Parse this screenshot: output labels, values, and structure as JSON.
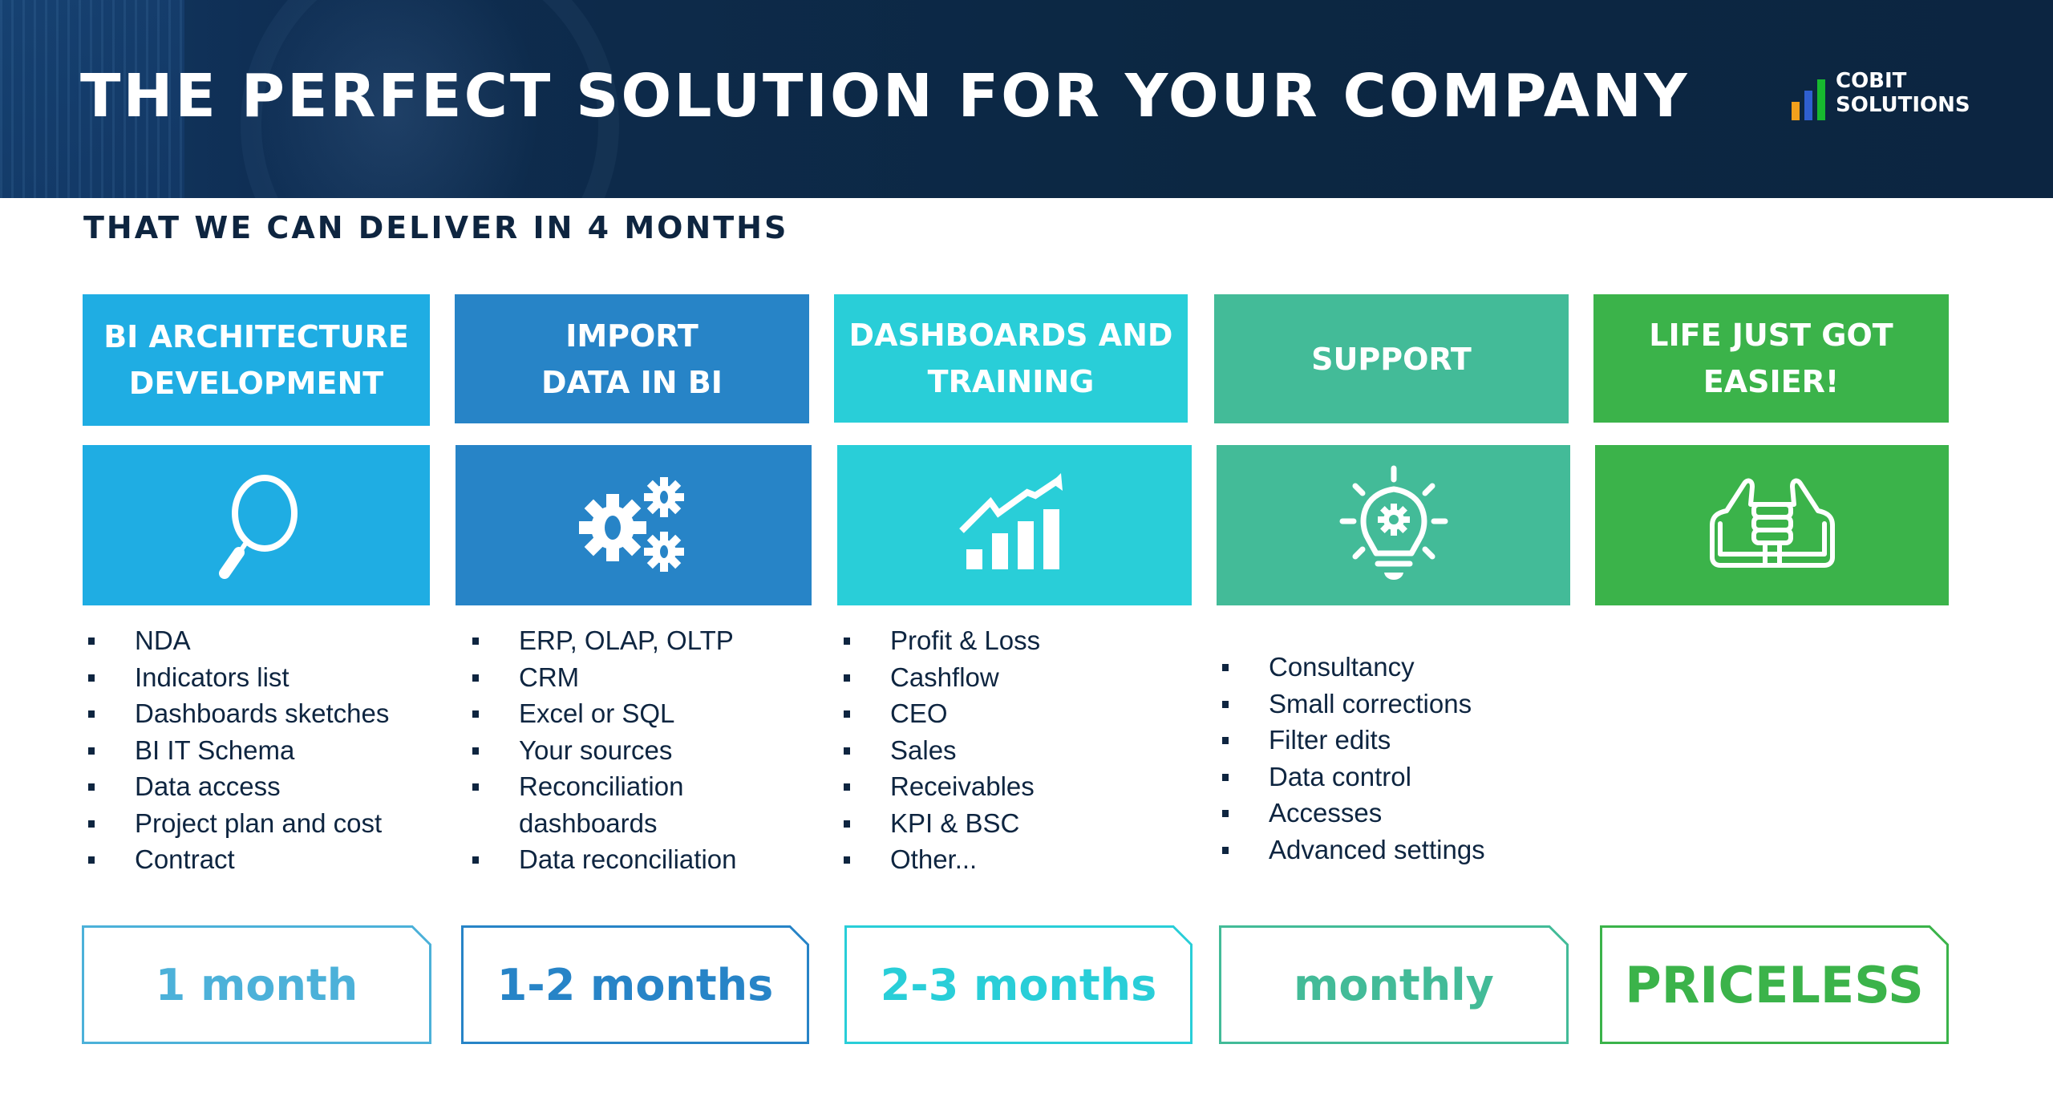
{
  "header": {
    "title": "THE PERFECT SOLUTION FOR YOUR COMPANY",
    "logo": {
      "line1": "COBIT",
      "line2": "SOLUTIONS",
      "bar_colors": [
        "#f2a01c",
        "#2f5fd0",
        "#17b92f"
      ]
    }
  },
  "subtitle": "THAT WE CAN DELIVER IN 4 MONTHS",
  "columns": [
    {
      "title": "BI ARCHITECTURE\nDEVELOPMENT",
      "icon": "magnifier-icon",
      "color": "#1fade3",
      "items": [
        "NDA",
        "Indicators list",
        "Dashboards sketches",
        "BI IT Schema",
        "Data access",
        "Project plan and cost",
        "Contract"
      ],
      "duration": "1 month",
      "duration_color": "#4cb1d9"
    },
    {
      "title": "IMPORT\nDATA IN BI",
      "icon": "gears-icon",
      "color": "#2784c7",
      "items": [
        "ERP, OLAP, OLTP",
        "CRM",
        "Excel or SQL",
        "Your sources",
        "Reconciliation dashboards",
        "Data reconciliation"
      ],
      "duration": "1-2 months",
      "duration_color": "#2784c7"
    },
    {
      "title": "DASHBOARDS AND\nTRAINING",
      "icon": "growth-chart-icon",
      "color": "#29ced8",
      "items": [
        "Profit & Loss",
        "Cashflow",
        "CEO",
        "Sales",
        "Receivables",
        "KPI & BSC",
        "Other..."
      ],
      "duration": "2-3 months",
      "duration_color": "#29ced8"
    },
    {
      "title": "SUPPORT",
      "icon": "lightbulb-gear-icon",
      "color": "#43bb98",
      "items": [
        "Consultancy",
        "Small corrections",
        "Filter edits",
        "Data control",
        "Accesses",
        "Advanced settings"
      ],
      "duration": "monthly",
      "duration_color": "#43bb98"
    },
    {
      "title": "LIFE JUST GOT\nEASIER!",
      "icon": "handshake-icon",
      "color": "#3bb34a",
      "items": [],
      "duration": "PRICELESS",
      "duration_color": "#3bb34a"
    }
  ]
}
